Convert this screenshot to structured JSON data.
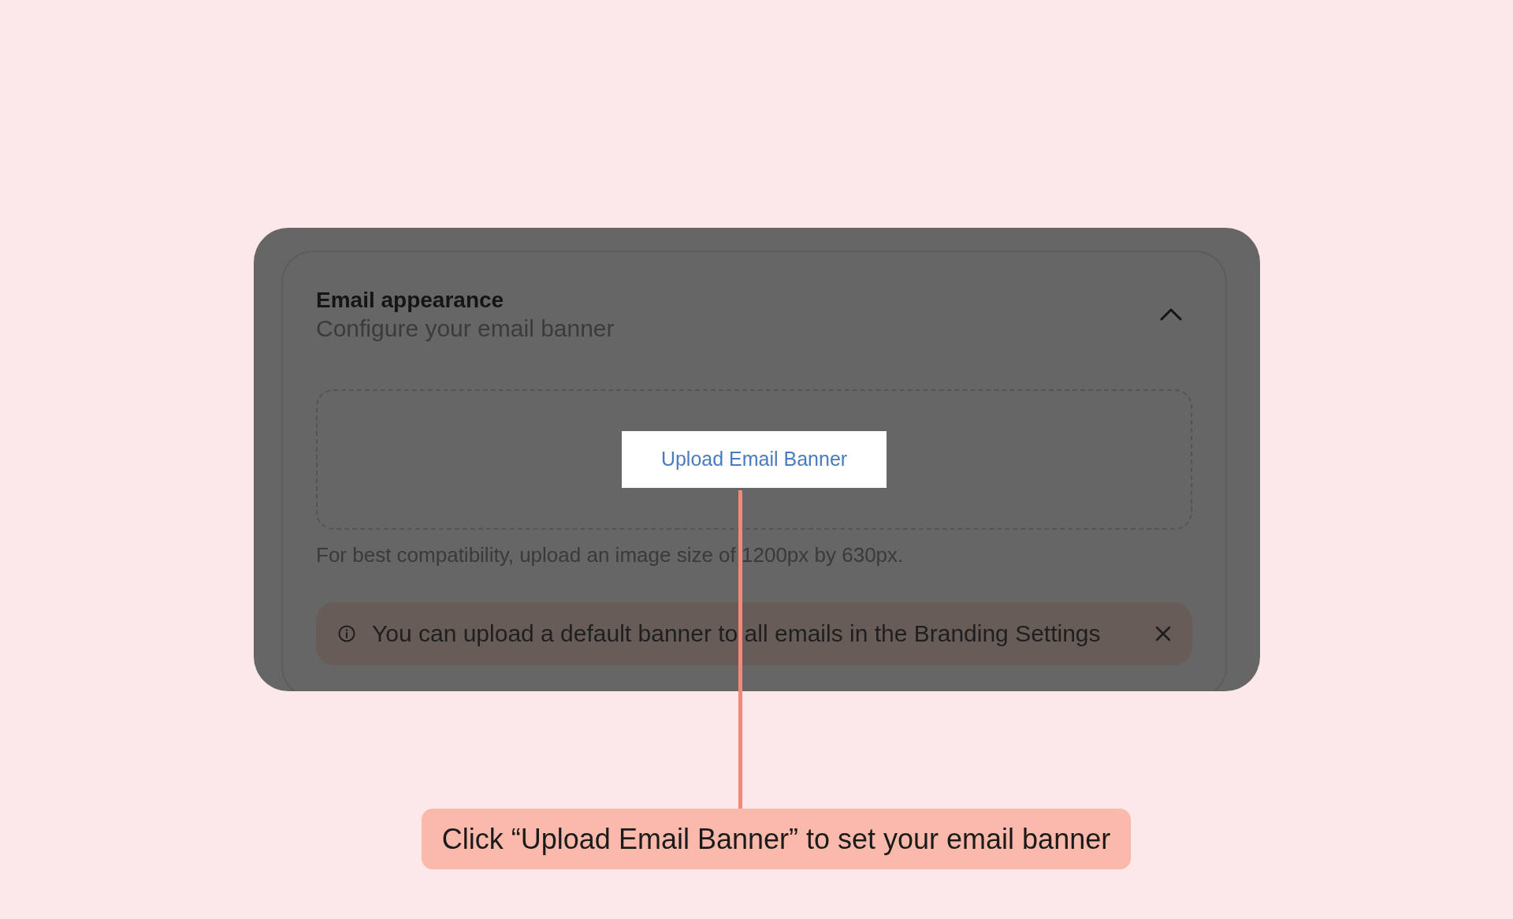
{
  "card": {
    "title": "Email appearance",
    "subtitle": "Configure your email banner",
    "expanded": true,
    "upload": {
      "button": "Upload Email Banner",
      "hint": "For best compatibility, upload an image size of 1200px by 630px."
    },
    "notice": {
      "text": "You can upload a default banner to all emails in the Branding Settings"
    }
  },
  "callout": {
    "text": "Click “Upload Email Banner” to set your email banner"
  }
}
